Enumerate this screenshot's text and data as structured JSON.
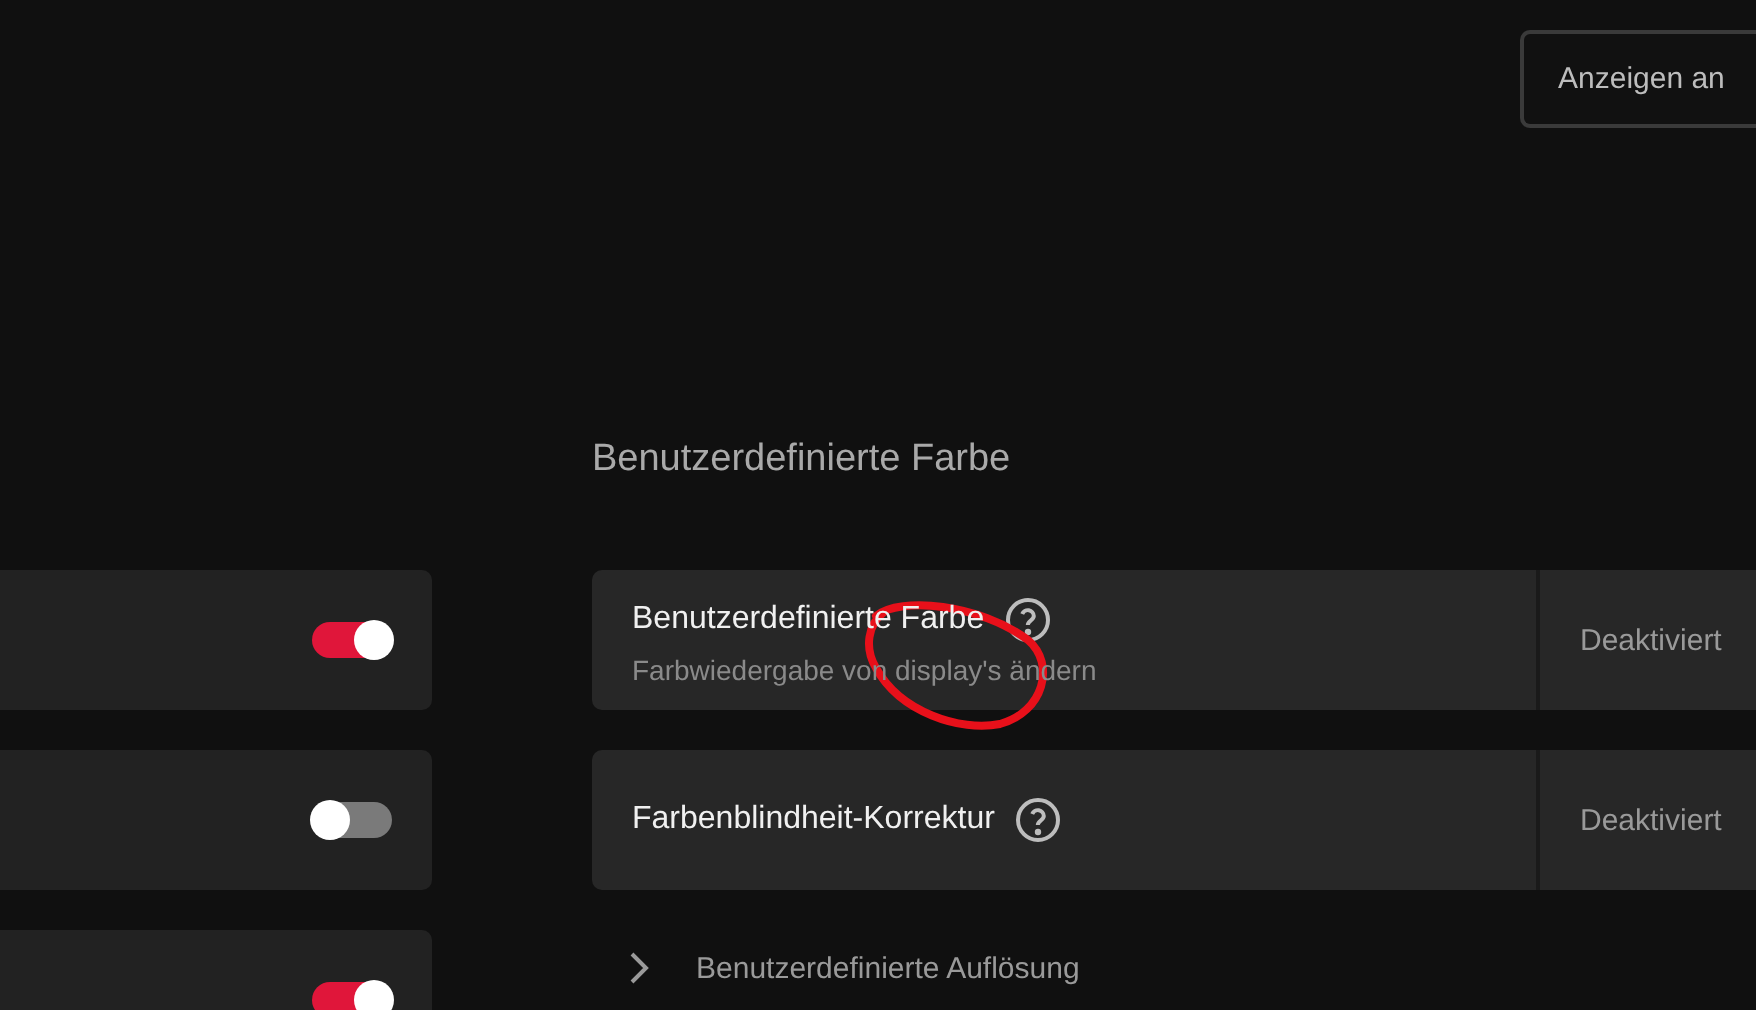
{
  "top_button": {
    "label": "Anzeigen an"
  },
  "toggle_rows": [
    {
      "on": true
    },
    {
      "on": false
    },
    {
      "on": true
    }
  ],
  "section": {
    "title": "Benutzerdefinierte Farbe",
    "settings": [
      {
        "label": "Benutzerdefinierte Farbe",
        "description": "Farbwiedergabe von display's ändern",
        "value": "Deaktiviert"
      },
      {
        "label": "Farbenblindheit-Korrektur",
        "value": "Deaktiviert"
      }
    ],
    "expander": {
      "label": "Benutzerdefinierte Auflösung",
      "expanded": false
    }
  }
}
